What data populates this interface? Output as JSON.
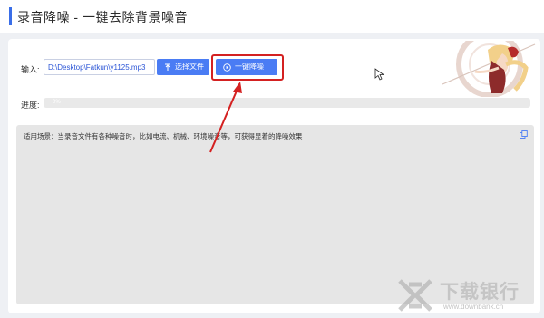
{
  "app": {
    "title": "录音降噪 - 一键去除背景噪音"
  },
  "form": {
    "input_label": "输入:",
    "input_value": "D:\\Desktop\\Fatkun\\y1125.mp3",
    "select_file_label": "选择文件",
    "denoise_label": "一键降噪",
    "progress_label": "进度:",
    "progress_value": "0%",
    "progress_fraction": 0
  },
  "description": {
    "text": "适用场景：当录音文件有各种噪音时，比如电流、机械、环境噪音等，可获得显着的降噪效果"
  },
  "watermark": {
    "text": "下载银行",
    "url": "www.downbank.cn"
  },
  "colors": {
    "accent": "#4a7cf4",
    "highlight": "#d42121",
    "title_bar": "#3a6ee8"
  },
  "icons": {
    "select": "upload-icon",
    "denoise": "play-circle-icon",
    "copy": "copy-icon"
  }
}
